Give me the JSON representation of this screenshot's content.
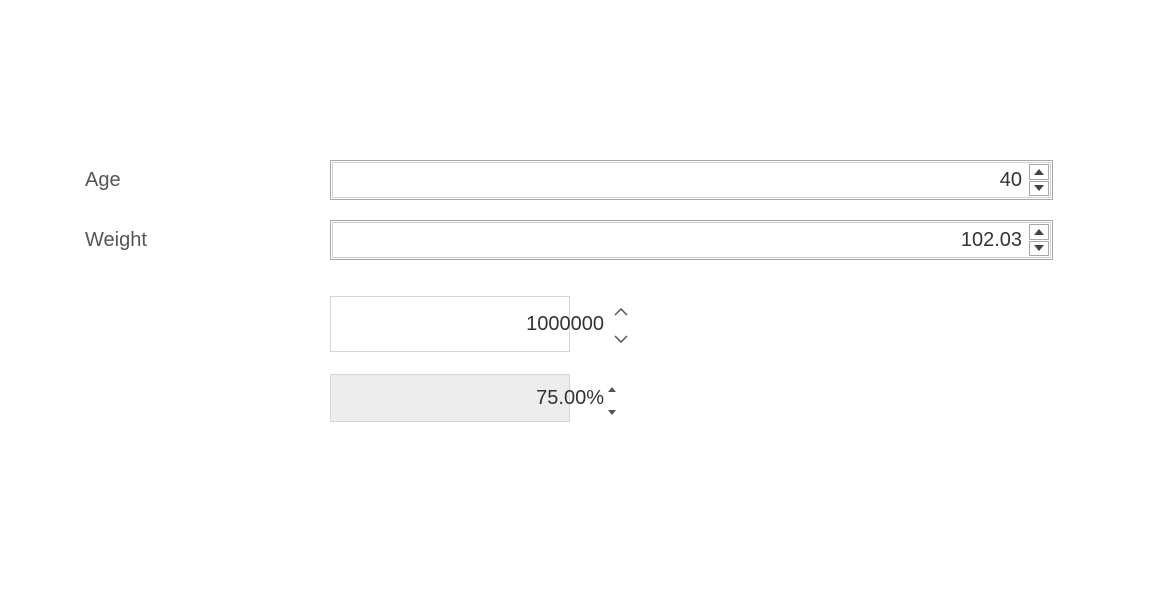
{
  "fields": {
    "age": {
      "label": "Age",
      "value": "40"
    },
    "weight": {
      "label": "Weight",
      "value": "102.03"
    },
    "amount": {
      "value": "1000000"
    },
    "percent": {
      "value": "75.00%"
    }
  }
}
